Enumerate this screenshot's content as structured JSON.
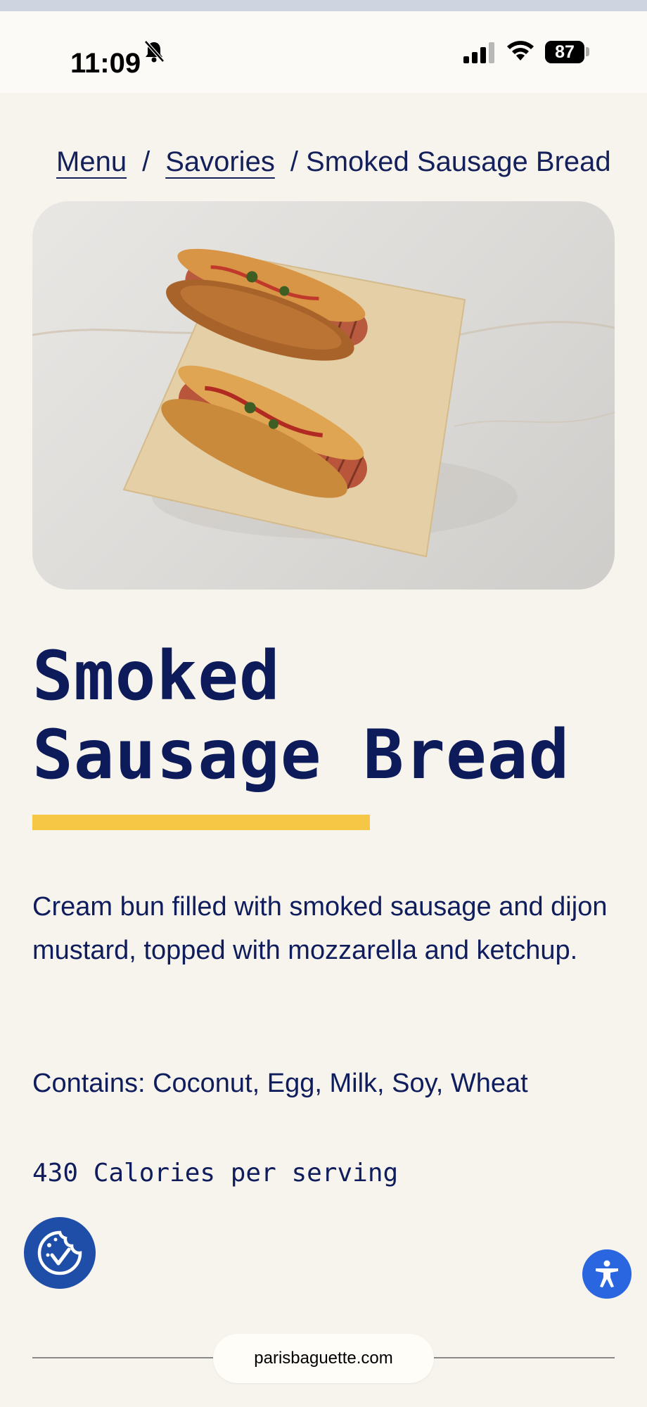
{
  "status_bar": {
    "time": "11:09",
    "battery": "87",
    "icons": [
      "bell-slash-icon",
      "signal-icon",
      "wifi-icon",
      "battery-icon"
    ]
  },
  "breadcrumb": {
    "items": [
      "Menu",
      "Savories"
    ],
    "separator": "/",
    "current": "/ Smoked Sausage Bread"
  },
  "product": {
    "image_alt": "smoked sausage bread photo",
    "title_line1": "Smoked",
    "title_line2": "Sausage Bread",
    "accent_color": "#f6c744",
    "description": "Cream bun filled with smoked sausage and dijon mustard, topped with mozzarella and ketchup.",
    "allergens": "Contains: Coconut, Egg, Milk, Soy, Wheat",
    "calories": "430 Calories per serving"
  },
  "widgets": {
    "cookie_icon": "cookie-check-icon",
    "accessibility_icon": "accessibility-icon"
  },
  "browser": {
    "url": "parisbaguette.com"
  },
  "colors": {
    "navy": "#0f1d5c",
    "background": "#f7f4ee",
    "cookie_button": "#1f4ea8",
    "a11y_button": "#2a66e0"
  }
}
